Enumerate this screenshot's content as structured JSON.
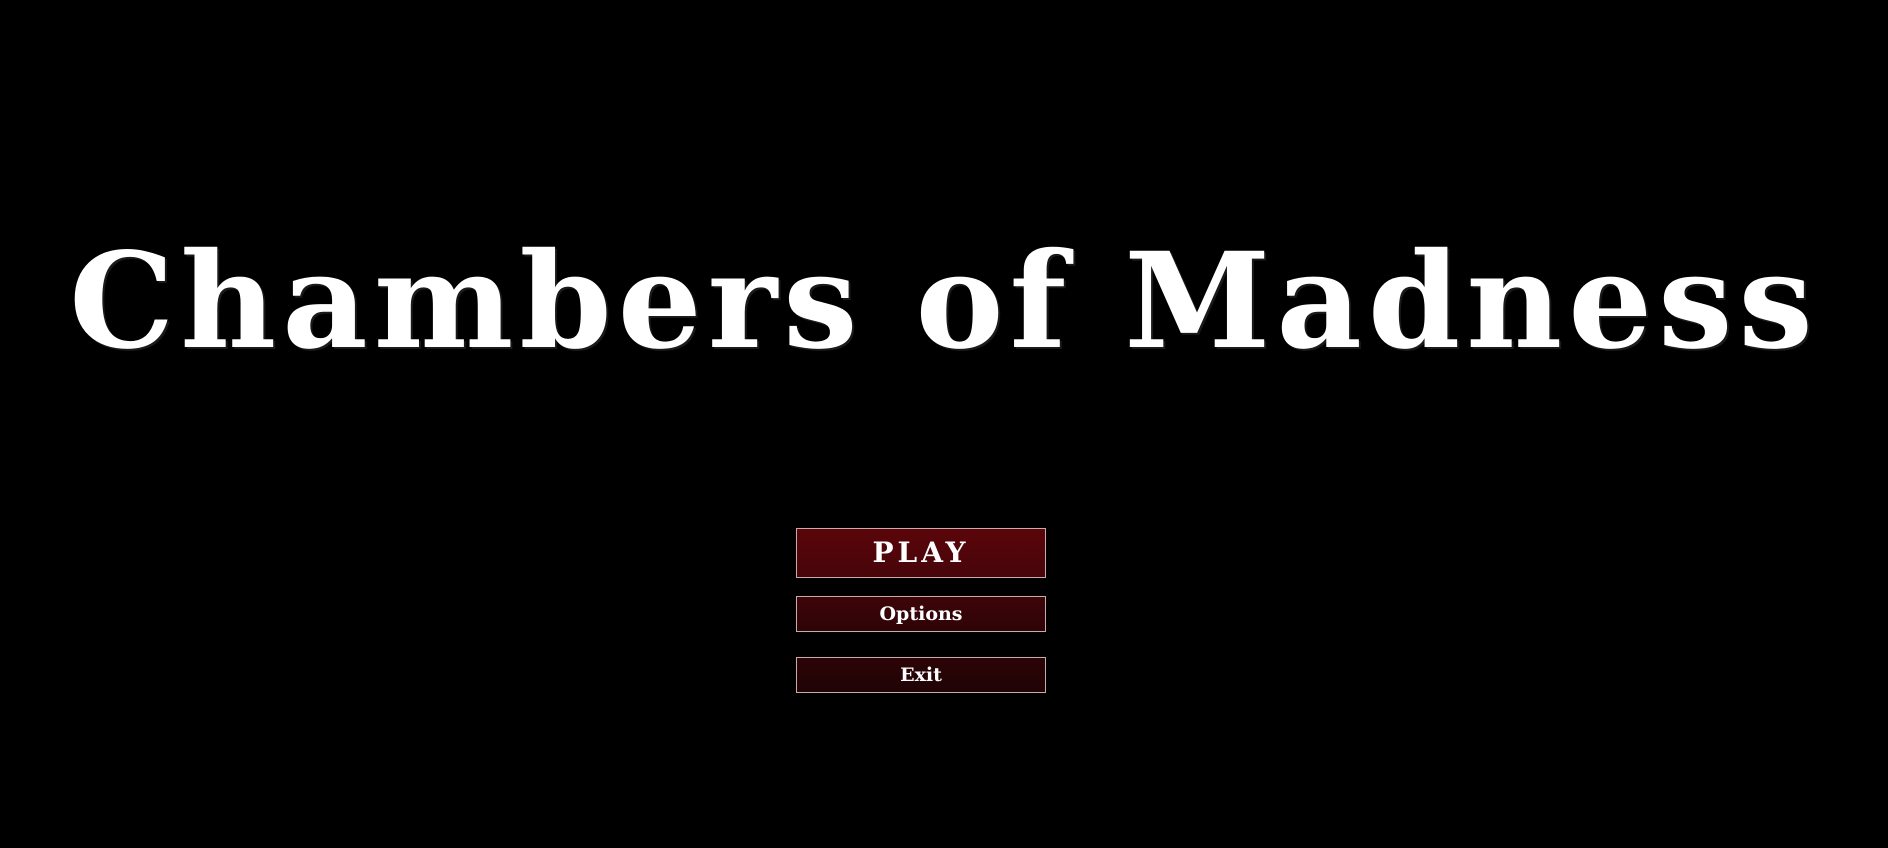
{
  "title": "Chambers of Madness",
  "menu": {
    "play_label": "PLAY",
    "options_label": "Options",
    "exit_label": "Exit"
  },
  "colors": {
    "background": "#000000",
    "title": "#ffffff",
    "play_button": "#520509",
    "options_button": "#360408",
    "exit_button": "#260306",
    "button_border": "#c9a9a9"
  }
}
